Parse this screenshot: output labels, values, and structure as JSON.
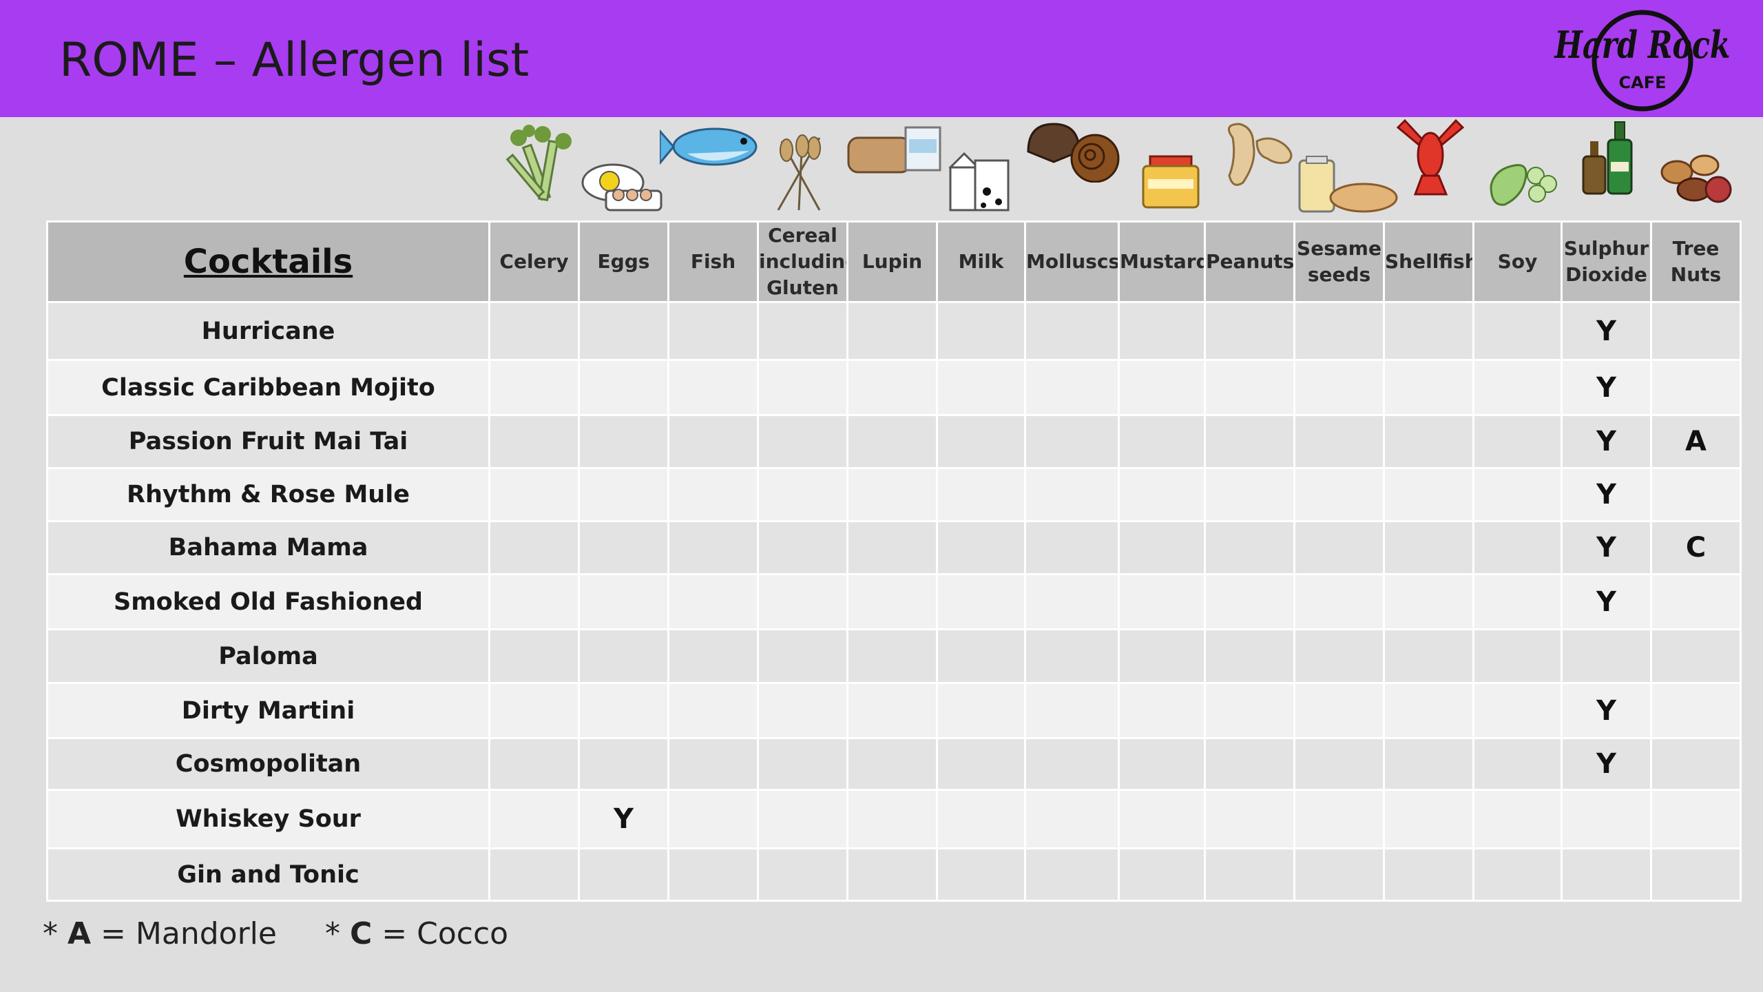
{
  "header": {
    "title": "ROME – Allergen list",
    "logo": {
      "line1": "Hard Rock",
      "line2": "CAFE"
    },
    "color": "#a83cf0"
  },
  "icons": [
    "celery-icon",
    "eggs-icon",
    "fish-icon",
    "wheat-icon",
    "lupin-icon",
    "milk-icon",
    "molluscs-icon",
    "mustard-icon",
    "peanuts-icon",
    "sesame-icon",
    "lobster-icon",
    "soy-icon",
    "bottles-icon",
    "nuts-icon"
  ],
  "table": {
    "corner": "Cocktails",
    "columns": [
      [
        "Celery"
      ],
      [
        "Eggs"
      ],
      [
        "Fish"
      ],
      [
        "Cereal",
        "including",
        "Gluten"
      ],
      [
        "Lupin"
      ],
      [
        "Milk"
      ],
      [
        "Molluscs"
      ],
      [
        "Mustard"
      ],
      [
        "Peanuts"
      ],
      [
        "Sesame",
        "seeds"
      ],
      [
        "Shellfish"
      ],
      [
        "Soy"
      ],
      [
        "Sulphur",
        "Dioxide"
      ],
      [
        "Tree",
        "Nuts"
      ]
    ],
    "rows": [
      {
        "name": "Hurricane",
        "cells": [
          "",
          "",
          "",
          "",
          "",
          "",
          "",
          "",
          "",
          "",
          "",
          "",
          "Y",
          ""
        ]
      },
      {
        "name": "Classic Caribbean Mojito",
        "cells": [
          "",
          "",
          "",
          "",
          "",
          "",
          "",
          "",
          "",
          "",
          "",
          "",
          "Y",
          ""
        ]
      },
      {
        "name": "Passion Fruit Mai Tai",
        "cells": [
          "",
          "",
          "",
          "",
          "",
          "",
          "",
          "",
          "",
          "",
          "",
          "",
          "Y",
          "A"
        ]
      },
      {
        "name": "Rhythm & Rose Mule",
        "cells": [
          "",
          "",
          "",
          "",
          "",
          "",
          "",
          "",
          "",
          "",
          "",
          "",
          "Y",
          ""
        ]
      },
      {
        "name": "Bahama Mama",
        "cells": [
          "",
          "",
          "",
          "",
          "",
          "",
          "",
          "",
          "",
          "",
          "",
          "",
          "Y",
          "C"
        ]
      },
      {
        "name": "Smoked Old Fashioned",
        "cells": [
          "",
          "",
          "",
          "",
          "",
          "",
          "",
          "",
          "",
          "",
          "",
          "",
          "Y",
          ""
        ]
      },
      {
        "name": "Paloma",
        "cells": [
          "",
          "",
          "",
          "",
          "",
          "",
          "",
          "",
          "",
          "",
          "",
          "",
          "",
          ""
        ]
      },
      {
        "name": "Dirty Martini",
        "cells": [
          "",
          "",
          "",
          "",
          "",
          "",
          "",
          "",
          "",
          "",
          "",
          "",
          "Y",
          ""
        ]
      },
      {
        "name": "Cosmopolitan",
        "cells": [
          "",
          "",
          "",
          "",
          "",
          "",
          "",
          "",
          "",
          "",
          "",
          "",
          "Y",
          ""
        ]
      },
      {
        "name": "Whiskey Sour",
        "cells": [
          "",
          "Y",
          "",
          "",
          "",
          "",
          "",
          "",
          "",
          "",
          "",
          "",
          "",
          ""
        ]
      },
      {
        "name": "Gin and Tonic",
        "cells": [
          "",
          "",
          "",
          "",
          "",
          "",
          "",
          "",
          "",
          "",
          "",
          "",
          "",
          ""
        ]
      }
    ]
  },
  "legend": [
    {
      "prefix": "* ",
      "key": "A",
      "text": " = Mandorle"
    },
    {
      "prefix": "* ",
      "key": "C",
      "text": " = Cocco"
    }
  ]
}
